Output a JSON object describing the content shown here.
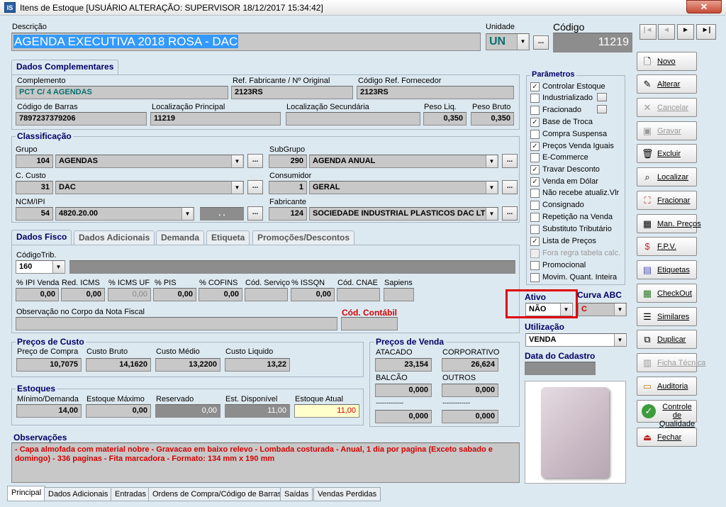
{
  "window": {
    "title": "Itens de Estoque  [USUÁRIO ALTERAÇÃO: SUPERVISOR 18/12/2017 15:34:42]",
    "close": "✕"
  },
  "header": {
    "descricao_label": "Descrição",
    "descricao": "AGENDA EXECUTIVA 2018 ROSA - DAC",
    "unidade_label": "Unidade",
    "unidade": "UN",
    "codigo_label": "Código",
    "codigo": "11219",
    "ellipsis": "..."
  },
  "nav": {
    "first": "|◄",
    "prev": "◄",
    "next": "►",
    "last": "►|"
  },
  "dados_complementares": {
    "tab": "Dados Complementares",
    "complemento_label": "Complemento",
    "complemento": "PCT C/ 4 AGENDAS",
    "ref_fab_label": "Ref. Fabricante / Nº Original",
    "ref_fab": "2123RS",
    "cod_ref_label": "Código Ref. Fornecedor",
    "cod_ref": "2123RS",
    "barras_label": "Código de Barras",
    "barras": "7897237379206",
    "loc_principal_label": "Localização Principal",
    "loc_principal": "11219",
    "loc_secundaria_label": "Localização Secundária",
    "loc_secundaria": "",
    "peso_liq_label": "Peso Liq.",
    "peso_liq": "0,350",
    "peso_bruto_label": "Peso Bruto",
    "peso_bruto": "0,350"
  },
  "classificacao": {
    "title": "Classificação",
    "grupo_label": "Grupo",
    "grupo_cod": "104",
    "grupo": "AGENDAS",
    "subgrupo_label": "SubGrupo",
    "subgrupo_cod": "290",
    "subgrupo": "AGENDA ANUAL",
    "custo_label": "C. Custo",
    "custo_cod": "31",
    "custo": "DAC",
    "consumidor_label": "Consumidor",
    "consumidor_cod": "1",
    "consumidor": "GERAL",
    "ncm_label": "NCM/IPI",
    "ncm_cod": "54",
    "ncm": "4820.20.00",
    "ncm_extra": ". .",
    "fabricante_label": "Fabricante",
    "fabricante_cod": "124",
    "fabricante": "SOCIEDADE INDUSTRIAL PLASTICOS DAC LTDA"
  },
  "tabs": [
    "Dados Fisco",
    "Dados Adicionais",
    "Demanda",
    "Etiqueta",
    "Promoções/Descontos"
  ],
  "fisco": {
    "codtrib_label": "CódigoTrib.",
    "codtrib": "160",
    "ipi_label": "% IPI Venda",
    "ipi": "0,00",
    "red_icms_label": "Red. ICMS",
    "red_icms": "0,00",
    "icms_uf_label": "% ICMS UF",
    "icms_uf": "0,00",
    "pis_label": "% PIS",
    "pis": "0,00",
    "cofins_label": "% COFINS",
    "cofins": "0,00",
    "cod_servico_label": "Cód. Serviço",
    "issqn_label": "% ISSQN",
    "issqn": "0,00",
    "cnae_label": "Cód. CNAE",
    "sapiens_label": "Sapiens",
    "obs_nf_label": "Observação no Corpo da Nota Fiscal",
    "cod_contabil_label": "Cód. Contábil"
  },
  "precos_custo": {
    "title": "Preços de Custo",
    "compra_label": "Preço de Compra",
    "compra": "10,7075",
    "bruto_label": "Custo Bruto",
    "bruto": "14,1620",
    "medio_label": "Custo Médio",
    "medio": "13,2200",
    "liquido_label": "Custo Liquido",
    "liquido": "13,22"
  },
  "estoques": {
    "title": "Estoques",
    "minimo_label": "Mínimo/Demanda",
    "minimo": "14,00",
    "maximo_label": "Estoque Máximo",
    "maximo": "0,00",
    "reservado_label": "Reservado",
    "reservado": "0,00",
    "disponivel_label": "Est. Disponível",
    "disponivel": "11,00",
    "atual_label": "Estoque Atual",
    "atual": "11,00"
  },
  "precos_venda": {
    "title": "Preços de Venda",
    "atacado_label": "ATACADO",
    "atacado": "23,154",
    "corporativo_label": "CORPORATIVO",
    "corporativo": "26,624",
    "balcao_label": "BALCÃO",
    "balcao": "0,000",
    "outros_label": "OUTROS",
    "outros": "0,000",
    "blank1_label": "-------------",
    "blank1": "0,000",
    "blank2_label": "-------------",
    "blank2": "0,000"
  },
  "observacoes": {
    "title": "Observações",
    "text": "- Capa almofada com material nobre - Gravacao em baixo relevo - Lombada costurada - Anual, 1 dia por pagina (Exceto sabado e domingo) - 336 paginas - Fita marcadora - Formato: 134 mm x 190 mm"
  },
  "parametros": {
    "title": "Parâmetros",
    "items": [
      {
        "label": "Controlar Estoque",
        "checked": "✓"
      },
      {
        "label": "Industrializado",
        "checked": ""
      },
      {
        "label": "Fracionado",
        "checked": ""
      },
      {
        "label": "Base de Troca",
        "checked": "✓"
      },
      {
        "label": "Compra Suspensa",
        "checked": ""
      },
      {
        "label": "Preços Venda Iguais",
        "checked": "✓"
      },
      {
        "label": "E-Commerce",
        "checked": ""
      },
      {
        "label": "Travar Desconto",
        "checked": "✓"
      },
      {
        "label": "Venda em Dólar",
        "checked": "✓"
      },
      {
        "label": "Não recebe atualiz.Vlr",
        "checked": ""
      },
      {
        "label": "Consignado",
        "checked": ""
      },
      {
        "label": "Repetição na Venda",
        "checked": ""
      },
      {
        "label": "Substituto Tributário",
        "checked": ""
      },
      {
        "label": "Lista de Preços",
        "checked": "✓"
      },
      {
        "label": "Fora regra tabela calc.",
        "checked": ""
      },
      {
        "label": "Promocional",
        "checked": ""
      },
      {
        "label": "Movim. Quant. Inteira",
        "checked": ""
      }
    ]
  },
  "status": {
    "ativo_label": "Ativo",
    "ativo": "NÃO",
    "curva_label": "Curva ABC",
    "curva": "C",
    "utilizacao_label": "Utilização",
    "utilizacao": "VENDA",
    "data_cadastro_label": "Data do Cadastro",
    "data_cadastro": ""
  },
  "side_buttons": {
    "novo": "Novo",
    "alterar": "Alterar",
    "cancelar": "Cancelar",
    "gravar": "Gravar",
    "excluir": "Excluir",
    "localizar": "Localizar",
    "fracionar": "Fracionar",
    "man_precos": "Man. Preços",
    "fpv": "F.P.V.",
    "etiquetas": "Etiquetas",
    "checkout": "CheckOut",
    "similares": "Similares",
    "duplicar": "Duplicar",
    "ficha": "Ficha Técnica",
    "auditoria": "Auditoria",
    "controle": "Controle de Qualidade",
    "fechar": "Fechar"
  },
  "bottom_tabs": [
    "Principal",
    "Dados Adicionais",
    "Entradas",
    "Ordens de Compra/Código de Barras",
    "Saídas",
    "Vendas Perdidas"
  ],
  "colors": {
    "accent": "#000066",
    "highlight": "#e00000",
    "background": "#dde9f1"
  }
}
